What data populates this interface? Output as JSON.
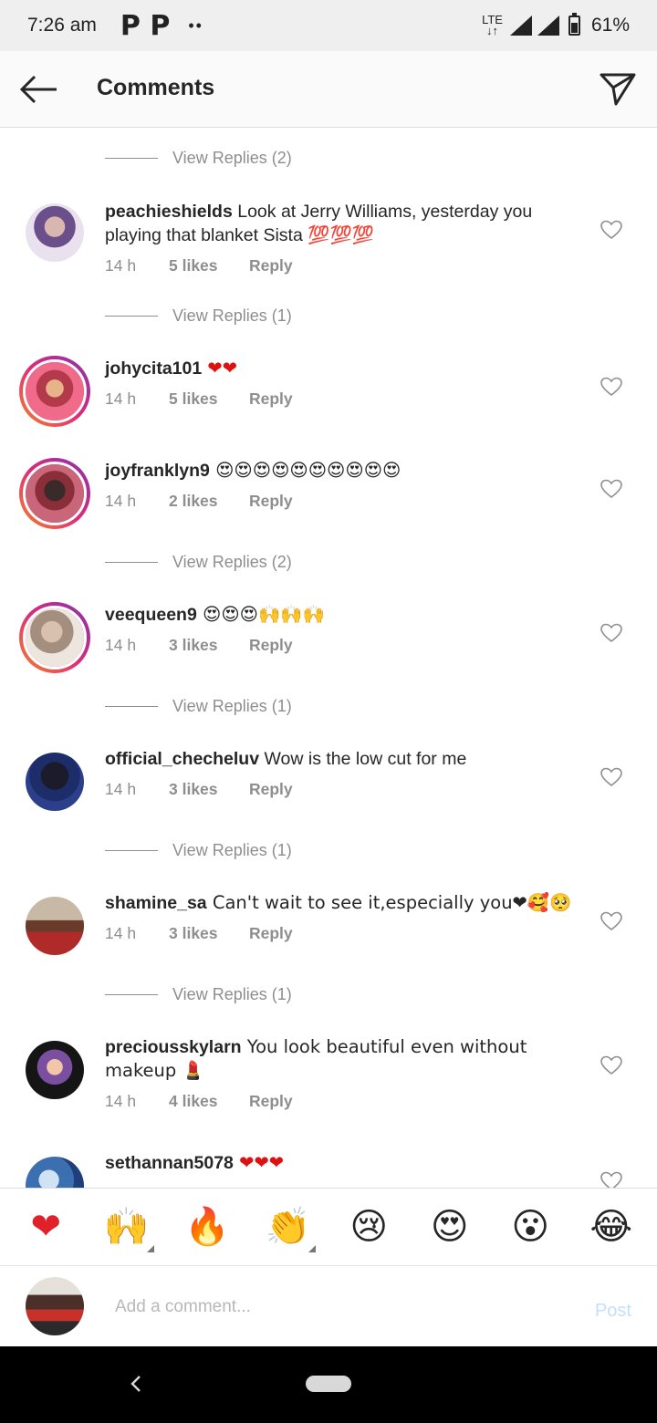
{
  "status_bar": {
    "time": "7:26 am",
    "notif_icons": "P  P",
    "dots": "••",
    "network": "LTE",
    "battery": "61%"
  },
  "header": {
    "title": "Comments"
  },
  "view_replies": [
    "View Replies (2)",
    "View Replies (1)",
    "View Replies (2)",
    "View Replies (1)",
    "View Replies (1)",
    "View Replies (1)"
  ],
  "comments": [
    {
      "user": "peachieshields",
      "text": " Look at Jerry Williams, yesterday you playing that blanket Sista 💯💯💯",
      "time": "14 h",
      "likes": "5 likes",
      "reply": "Reply"
    },
    {
      "user": "johycita101",
      "text": " ❤❤",
      "time": "14 h",
      "likes": "5 likes",
      "reply": "Reply"
    },
    {
      "user": "joyfranklyn9",
      "text": " 😍😍😍😍😍😍😍😍😍😍",
      "time": "14 h",
      "likes": "2 likes",
      "reply": "Reply"
    },
    {
      "user": "veequeen9",
      "text": " 😍😍😍🙌🙌🙌",
      "time": "14 h",
      "likes": "3 likes",
      "reply": "Reply"
    },
    {
      "user": "official_checheluv",
      "text": " Wow is the low cut for me",
      "time": "14 h",
      "likes": "3 likes",
      "reply": "Reply"
    },
    {
      "user": "shamine_sa",
      "text": " Can't wait to see it,especially you❤🥰🥺",
      "time": "14 h",
      "likes": "3 likes",
      "reply": "Reply"
    },
    {
      "user": "preciousskylarn",
      "text": " You look beautiful even without makeup 💄",
      "time": "14 h",
      "likes": "4 likes",
      "reply": "Reply"
    },
    {
      "user": "sethannan5078",
      "text": " ❤❤❤",
      "time": "",
      "likes": "",
      "reply": ""
    }
  ],
  "reactions": [
    "❤",
    "🙌",
    "🔥",
    "👏",
    "😢",
    "😍",
    "😮",
    "😂"
  ],
  "composer": {
    "placeholder": "Add a comment...",
    "post_label": "Post"
  },
  "colors": {
    "meta_gray": "#8e8e8e",
    "ring_start": "#f58529",
    "ring_end": "#8134af",
    "post_disabled": "#c3dffa"
  }
}
